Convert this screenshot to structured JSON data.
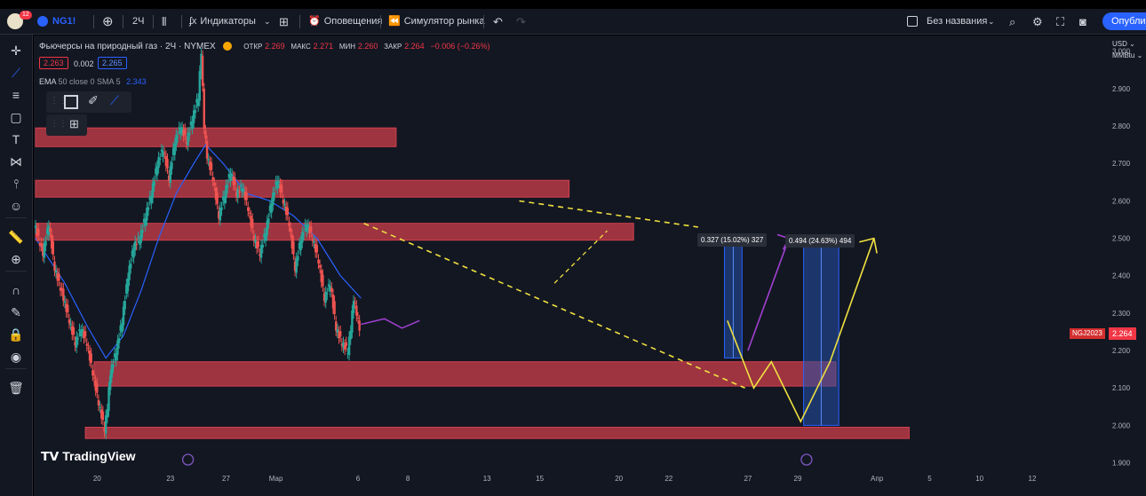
{
  "toolbar": {
    "symbol": "NG1!",
    "interval": "2Ч",
    "indicators_label": "Индикаторы",
    "alerts_label": "Оповещения",
    "simulator_label": "Симулятор рынка",
    "layout_name": "Без названия",
    "publish_label": "Опублико",
    "notifications_count": "12"
  },
  "legend": {
    "title": "Фьючерсы на природный газ · 2Ч · NYMEX",
    "open_label": "ОТКР",
    "open_value": "2.269",
    "high_label": "МАКС",
    "high_value": "2.271",
    "low_label": "МИН",
    "low_value": "2.260",
    "close_label": "ЗАКР",
    "close_value": "2.264",
    "change": "−0.006 (−0.26%)",
    "bid": "2.263",
    "spread": "0.002",
    "ask": "2.265",
    "ema_label": "EMA",
    "ema_params": "50 close 0 SMA 5",
    "ema_value": "2.343",
    "currency": "USD",
    "unit": "MMBtu"
  },
  "price_tag": {
    "symbol": "NGJ2023",
    "value": "2.264"
  },
  "watermark": "TradingView",
  "measure_labels": [
    "0.327 (15.02%) 327",
    "0.494 (24.63%) 494"
  ],
  "colors": {
    "zone": "#d3404c",
    "ema": "#2962ff",
    "projection_yellow": "#f0e040",
    "projection_purple": "#a040d0",
    "measure_box": "#2450a8",
    "bg": "#131722"
  },
  "chart_data": {
    "type": "line",
    "ylim": [
      1.88,
      3.08
    ],
    "y_ticks": [
      "3.000",
      "2.900",
      "2.800",
      "2.700",
      "2.600",
      "2.500",
      "2.400",
      "2.300",
      "2.200",
      "2.100",
      "2.000",
      "1.900"
    ],
    "x_ticks": [
      "20",
      "23",
      "27",
      "Мар",
      "6",
      "8",
      "13",
      "15",
      "20",
      "22",
      "27",
      "29",
      "Апр",
      "5",
      "10",
      "12"
    ],
    "price_series": [
      {
        "t": 0,
        "v": 2.54
      },
      {
        "t": 3,
        "v": 2.46
      },
      {
        "t": 5,
        "v": 2.54
      },
      {
        "t": 7,
        "v": 2.42
      },
      {
        "t": 10,
        "v": 2.34
      },
      {
        "t": 12,
        "v": 2.28
      },
      {
        "t": 14,
        "v": 2.22
      },
      {
        "t": 16,
        "v": 2.26
      },
      {
        "t": 18,
        "v": 2.22
      },
      {
        "t": 20,
        "v": 2.14
      },
      {
        "t": 22,
        "v": 2.06
      },
      {
        "t": 24,
        "v": 1.99
      },
      {
        "t": 25,
        "v": 2.05
      },
      {
        "t": 26,
        "v": 2.14
      },
      {
        "t": 28,
        "v": 2.2
      },
      {
        "t": 30,
        "v": 2.28
      },
      {
        "t": 32,
        "v": 2.4
      },
      {
        "t": 34,
        "v": 2.48
      },
      {
        "t": 36,
        "v": 2.5
      },
      {
        "t": 38,
        "v": 2.56
      },
      {
        "t": 40,
        "v": 2.62
      },
      {
        "t": 42,
        "v": 2.7
      },
      {
        "t": 44,
        "v": 2.74
      },
      {
        "t": 46,
        "v": 2.66
      },
      {
        "t": 48,
        "v": 2.76
      },
      {
        "t": 50,
        "v": 2.8
      },
      {
        "t": 52,
        "v": 2.76
      },
      {
        "t": 54,
        "v": 2.82
      },
      {
        "t": 56,
        "v": 2.88
      },
      {
        "t": 57,
        "v": 3.0
      },
      {
        "t": 58,
        "v": 2.8
      },
      {
        "t": 59,
        "v": 2.72
      },
      {
        "t": 61,
        "v": 2.66
      },
      {
        "t": 63,
        "v": 2.56
      },
      {
        "t": 65,
        "v": 2.62
      },
      {
        "t": 67,
        "v": 2.68
      },
      {
        "t": 69,
        "v": 2.62
      },
      {
        "t": 71,
        "v": 2.64
      },
      {
        "t": 73,
        "v": 2.58
      },
      {
        "t": 75,
        "v": 2.5
      },
      {
        "t": 77,
        "v": 2.46
      },
      {
        "t": 79,
        "v": 2.52
      },
      {
        "t": 81,
        "v": 2.6
      },
      {
        "t": 83,
        "v": 2.66
      },
      {
        "t": 85,
        "v": 2.6
      },
      {
        "t": 87,
        "v": 2.54
      },
      {
        "t": 89,
        "v": 2.42
      },
      {
        "t": 91,
        "v": 2.5
      },
      {
        "t": 93,
        "v": 2.54
      },
      {
        "t": 95,
        "v": 2.5
      },
      {
        "t": 97,
        "v": 2.44
      },
      {
        "t": 99,
        "v": 2.34
      },
      {
        "t": 101,
        "v": 2.38
      },
      {
        "t": 103,
        "v": 2.26
      },
      {
        "t": 105,
        "v": 2.22
      },
      {
        "t": 107,
        "v": 2.2
      },
      {
        "t": 108,
        "v": 2.26
      },
      {
        "t": 109,
        "v": 2.34
      },
      {
        "t": 110,
        "v": 2.3
      },
      {
        "t": 111,
        "v": 2.26
      }
    ],
    "ema_series": [
      {
        "t": 0,
        "v": 2.5
      },
      {
        "t": 10,
        "v": 2.38
      },
      {
        "t": 18,
        "v": 2.26
      },
      {
        "t": 24,
        "v": 2.18
      },
      {
        "t": 30,
        "v": 2.24
      },
      {
        "t": 36,
        "v": 2.36
      },
      {
        "t": 42,
        "v": 2.5
      },
      {
        "t": 48,
        "v": 2.62
      },
      {
        "t": 54,
        "v": 2.7
      },
      {
        "t": 58,
        "v": 2.75
      },
      {
        "t": 64,
        "v": 2.7
      },
      {
        "t": 72,
        "v": 2.62
      },
      {
        "t": 80,
        "v": 2.6
      },
      {
        "t": 88,
        "v": 2.56
      },
      {
        "t": 96,
        "v": 2.5
      },
      {
        "t": 104,
        "v": 2.4
      },
      {
        "t": 111,
        "v": 2.34
      }
    ]
  }
}
